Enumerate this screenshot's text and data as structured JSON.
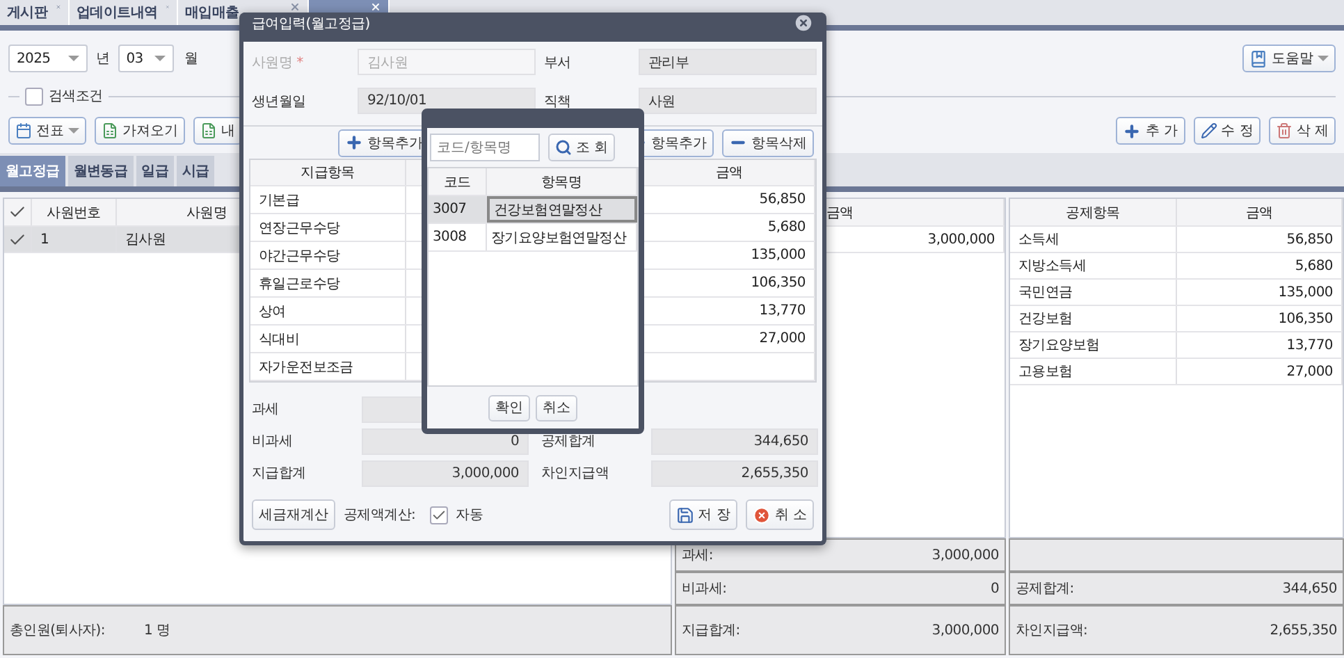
{
  "tabs": [
    {
      "label": "게시판",
      "selected": false
    },
    {
      "label": "업데이트내역",
      "selected": false
    },
    {
      "label": "매입매출",
      "selected": false
    },
    {
      "selected": true
    }
  ],
  "toolbar": {
    "year": "2025",
    "year_unit": "년",
    "month": "03",
    "month_unit": "월",
    "help_button": "도움말"
  },
  "search_toggle": {
    "label": "검색조건",
    "checked": false
  },
  "actions_left": [
    {
      "label": "전표",
      "kind": "menu"
    },
    {
      "label": "가져오기",
      "kind": "sheet"
    },
    {
      "label": "내",
      "kind": "sheet"
    }
  ],
  "actions_right": [
    {
      "label": "추 가",
      "kind": "add"
    },
    {
      "label": "수 정",
      "kind": "edit"
    },
    {
      "label": "삭 제",
      "kind": "delete"
    }
  ],
  "pay_tabs": [
    {
      "label": "월고정급",
      "selected": true
    },
    {
      "label": "월변동급",
      "selected": false
    },
    {
      "label": "일급",
      "selected": false
    },
    {
      "label": "시급",
      "selected": false
    }
  ],
  "employee_grid": {
    "all_checked": true,
    "columns": [
      "사원번호",
      "사원명"
    ],
    "rows": [
      {
        "checked": true,
        "selected": true,
        "cells": [
          "1",
          "김사원"
        ]
      }
    ]
  },
  "earnings_panel": {
    "header": "금액",
    "rows": [
      "3,000,000"
    ],
    "summary": [
      {
        "label": "과세:",
        "value": "3,000,000"
      },
      {
        "label": "비과세:",
        "value": "0"
      },
      {
        "label": "지급합계:",
        "value": "3,000,000"
      }
    ]
  },
  "deductions_panel": {
    "columns": [
      "공제항목",
      "금액"
    ],
    "rows": [
      [
        "소득세",
        "56,850"
      ],
      [
        "지방소득세",
        "5,680"
      ],
      [
        "국민연금",
        "135,000"
      ],
      [
        "건강보험",
        "106,350"
      ],
      [
        "장기요양보험",
        "13,770"
      ],
      [
        "고용보험",
        "27,000"
      ]
    ],
    "summary": [
      {
        "label": "공제합계:",
        "value": "344,650"
      },
      {
        "label": "차인지급액:",
        "value": "2,655,350"
      }
    ]
  },
  "footer": {
    "label": "총인원(퇴사자):",
    "value": "1 명"
  },
  "modal": {
    "title": "급여입력(월고정급)",
    "fields": [
      {
        "label": "사원명",
        "mark": "*",
        "value": "김사원",
        "disabled": true
      },
      {
        "label": "부서",
        "value": "관리부",
        "disabled": false
      },
      {
        "label": "생년월일",
        "value": "92/10/01",
        "disabled": false
      },
      {
        "label": "직책",
        "value": "사원",
        "disabled": false
      }
    ],
    "item_buttons": [
      {
        "label": "항목추가",
        "kind": "add"
      },
      {
        "label": "항목추가",
        "kind": "add"
      },
      {
        "label": "항목삭제",
        "kind": "remove"
      }
    ],
    "earnings_header": "지급항목",
    "earnings": [
      "기본급",
      "연장근무수당",
      "야간근무수당",
      "휴일근로수당",
      "상여",
      "식대비",
      "자가운전보조금"
    ],
    "deductions_header": "금액",
    "deductions": [
      "56,850",
      "5,680",
      "135,000",
      "106,350",
      "13,770",
      "27,000"
    ],
    "totals_left": [
      {
        "label": "과세"
      },
      {
        "label": "비과세",
        "value": "0"
      },
      {
        "label": "지급합계",
        "value": "3,000,000"
      }
    ],
    "totals_right": [
      {
        "label": "공제합계",
        "value": "344,650"
      },
      {
        "label": "차인지급액",
        "value": "2,655,350"
      }
    ],
    "recalc_button": "세금재계산",
    "auto_calc": {
      "label": "공제액계산:",
      "option": "자동",
      "checked": true
    },
    "save_button": "저 장",
    "cancel_button": "취 소"
  },
  "popup": {
    "search_placeholder": "코드/항목명",
    "search_button": "조 회",
    "columns": [
      "코드",
      "항목명"
    ],
    "rows": [
      {
        "code": "3007",
        "name": "건강보험연말정산",
        "selected": true
      },
      {
        "code": "3008",
        "name": "장기요양보험연말정산",
        "selected": false
      }
    ],
    "buttons": [
      "확인",
      "취소"
    ]
  }
}
